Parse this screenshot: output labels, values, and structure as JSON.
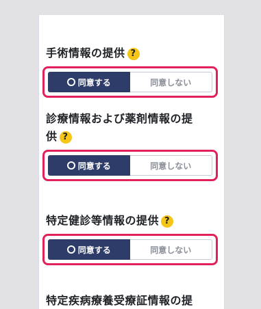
{
  "sections": [
    {
      "title": "手術情報の提供",
      "help": "?",
      "agree": "同意する",
      "disagree": "同意しない",
      "selected": "agree"
    },
    {
      "title_line1": "診療情報および薬剤情報の提",
      "title_line2": "供",
      "help": "?",
      "agree": "同意する",
      "disagree": "同意しない",
      "selected": "agree"
    },
    {
      "title": "特定健診等情報の提供",
      "help": "?",
      "agree": "同意する",
      "disagree": "同意しない",
      "selected": "agree"
    },
    {
      "title": "特定疾病療養受療証情報の提"
    }
  ],
  "colors": {
    "selected": "#2d3c69",
    "highlight": "#e0215a",
    "help_badge": "#f5c518"
  }
}
